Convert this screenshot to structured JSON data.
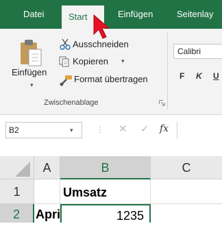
{
  "ribbon_tabs": {
    "datei": "Datei",
    "start": "Start",
    "einfuegen": "Einfügen",
    "seitenlayout": "Seitenlay"
  },
  "clipboard_group": {
    "paste_label": "Einfügen",
    "cut_label": "Ausschneiden",
    "copy_label": "Kopieren",
    "format_painter_label": "Format übertragen",
    "group_label": "Zwischenablage"
  },
  "font_group": {
    "font_name": "Calibri",
    "bold": "F",
    "italic": "K",
    "underline": "U"
  },
  "formula_bar": {
    "name_box": "B2",
    "fx": "fx"
  },
  "grid": {
    "columns": [
      "A",
      "B",
      "C"
    ],
    "rows": [
      "1",
      "2"
    ],
    "cells": {
      "A1": "",
      "B1": "Umsatz",
      "C1": "",
      "A2": "April",
      "B2": "1235",
      "C2": ""
    },
    "selected_cell": "B2"
  },
  "colors": {
    "accent": "#217346",
    "cursor": "#e81123"
  },
  "icons": [
    "paste-icon",
    "cut-icon",
    "copy-icon",
    "format-painter-icon",
    "dialog-launcher-icon",
    "cancel-icon",
    "enter-icon",
    "function-icon",
    "mouse-pointer-icon"
  ]
}
